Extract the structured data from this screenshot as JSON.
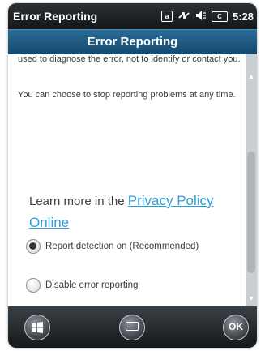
{
  "status_bar": {
    "title": "Error Reporting",
    "icons": [
      "app-a-icon",
      "signal-arrows-icon",
      "speaker-icon",
      "battery-icon"
    ],
    "app_glyph": "a",
    "battery_glyph": "C",
    "time": "5:28"
  },
  "header": {
    "title": "Error Reporting"
  },
  "content": {
    "para1": "used to diagnose the error, not to identify or contact you.",
    "para2": "You can choose to stop reporting problems at any time.",
    "learn_prefix": "Learn more in the ",
    "learn_link": "Privacy Policy Online",
    "radio_options": [
      {
        "label": "Report detection on (Recommended)",
        "checked": true
      },
      {
        "label": "Disable error reporting",
        "checked": false
      }
    ]
  },
  "bottom_bar": {
    "start_icon": "windows-start-icon",
    "keyboard_icon": "keyboard-icon",
    "ok_label": "OK"
  },
  "colors": {
    "header_bg": "#1f5b83",
    "link": "#2a9fd8",
    "status_bg": "#1d2226"
  }
}
